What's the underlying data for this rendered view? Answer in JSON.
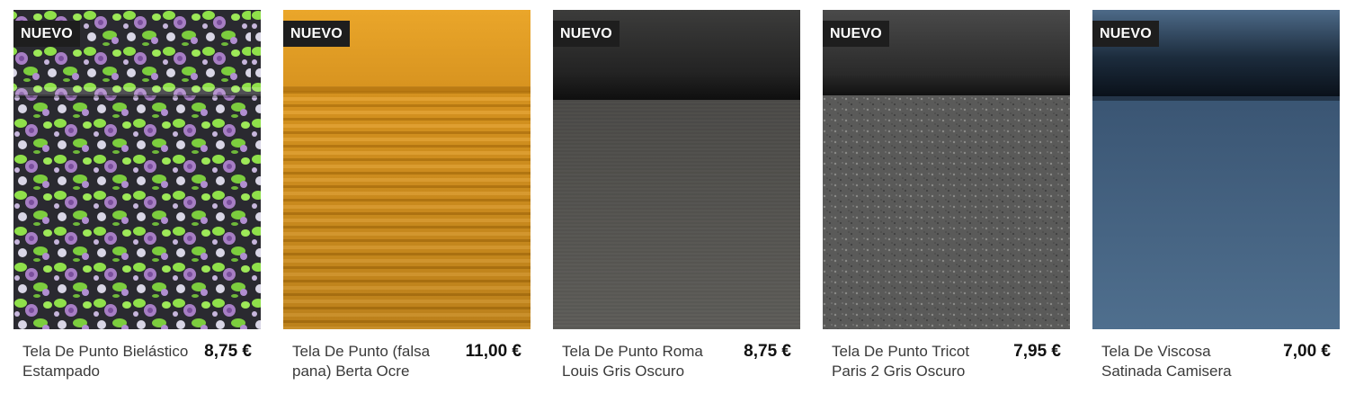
{
  "badge_label": "NUEVO",
  "products": [
    {
      "name": "Tela De Punto Bielástico Estampado",
      "price": "8,75 €",
      "swatch": "floral-lilac-green"
    },
    {
      "name": "Tela De Punto (falsa pana) Berta Ocre",
      "price": "11,00 €",
      "swatch": "ochre-corduroy"
    },
    {
      "name": "Tela De Punto Roma Louis Gris Oscuro",
      "price": "8,75 €",
      "swatch": "dark-grey-knit"
    },
    {
      "name": "Tela De Punto Tricot Paris 2 Gris Oscuro",
      "price": "7,95 €",
      "swatch": "dark-grey-melange"
    },
    {
      "name": "Tela De Viscosa Satinada Camisera",
      "price": "7,00 €",
      "swatch": "navy-satin"
    }
  ]
}
